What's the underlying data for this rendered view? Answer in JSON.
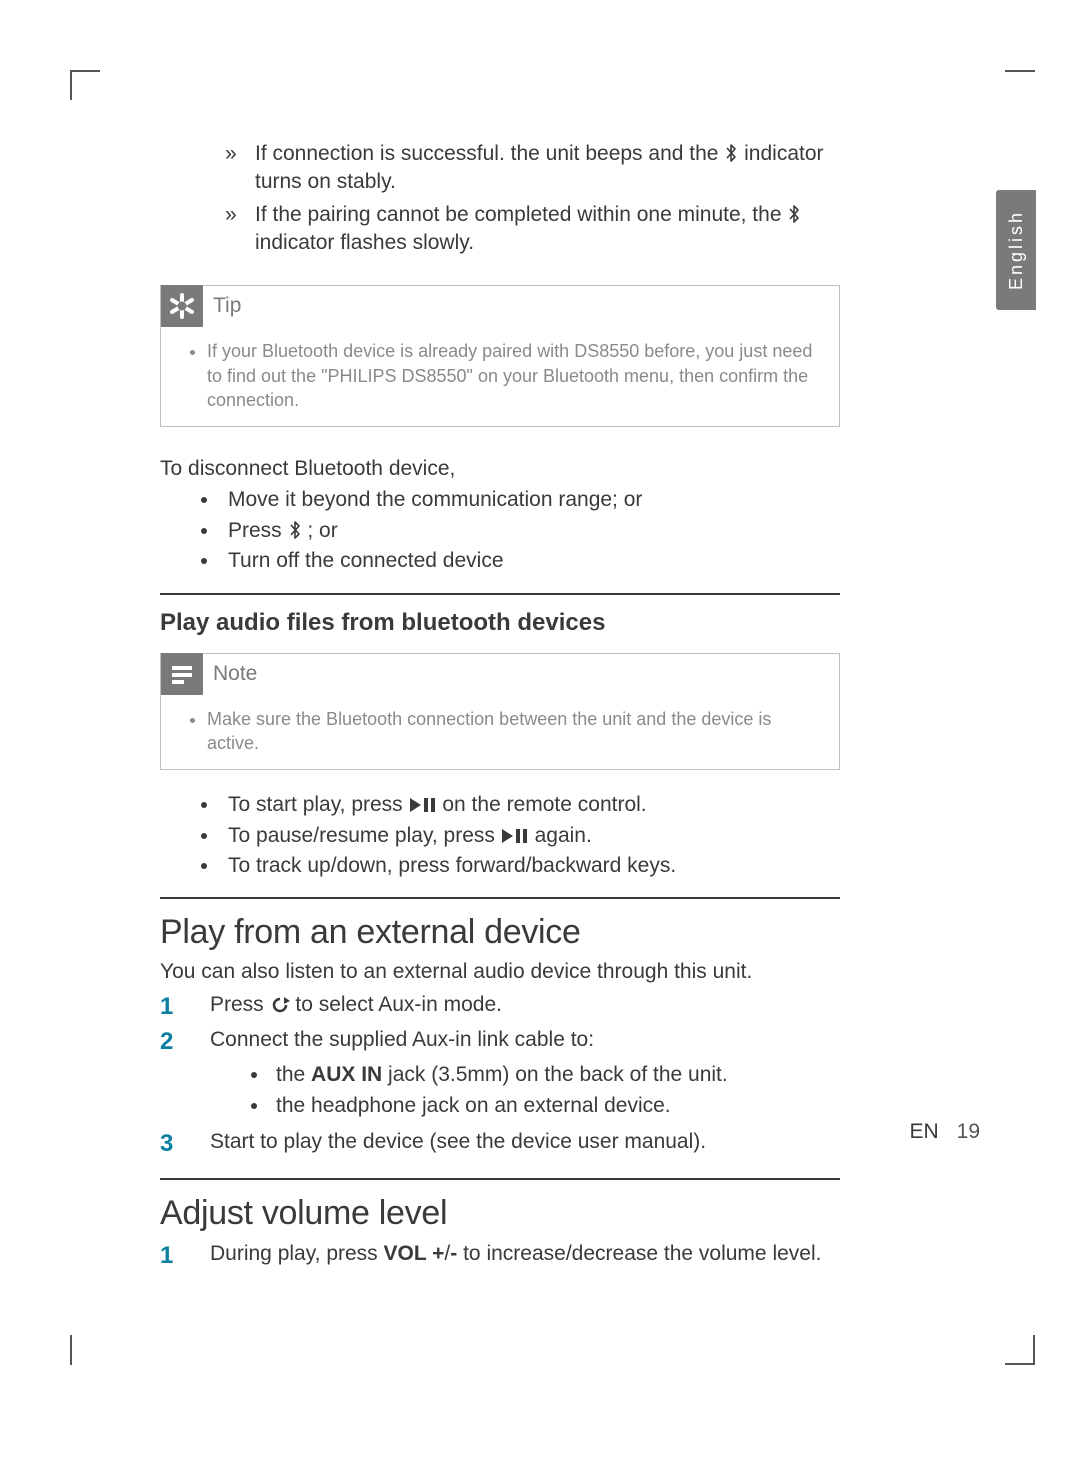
{
  "language_tab": "English",
  "results": [
    {
      "pre": "If connection is successful. the unit beeps and the ",
      "post": " indicator turns on stably."
    },
    {
      "pre": "If the pairing cannot be completed within one minute, the ",
      "post": " indicator flashes slowly."
    }
  ],
  "tip": {
    "title": "Tip",
    "body": "If your Bluetooth device is already paired with DS8550 before, you just need to find out the \"PHILIPS DS8550\" on your Bluetooth menu, then confirm the connection."
  },
  "disconnect": {
    "heading": "To disconnect Bluetooth device,",
    "items": {
      "a": "Move it beyond the communication range; or",
      "b_pre": "Press ",
      "b_post": " ; or",
      "c": "Turn off the connected device"
    }
  },
  "play_bt": {
    "heading": "Play audio files from bluetooth devices",
    "note_title": "Note",
    "note_body": "Make sure the Bluetooth connection between the unit and the device is active.",
    "items": {
      "a_pre": "To start play, press ",
      "a_post": " on the remote control.",
      "b_pre": "To pause/resume play, press ",
      "b_post": " again.",
      "c": "To track up/down, press forward/backward keys."
    }
  },
  "external": {
    "heading": "Play from an external device",
    "intro": "You can also listen to an external audio device through this unit.",
    "step1_pre": "Press ",
    "step1_post": " to select Aux-in mode.",
    "step2": "Connect the supplied Aux-in link cable to:",
    "step2a_pre": "the ",
    "step2a_bold": "AUX IN",
    "step2a_post": "  jack (3.5mm) on the back of the unit.",
    "step2b": "the headphone jack on an external device.",
    "step3": "Start to play the device (see the device user manual)."
  },
  "volume": {
    "heading": "Adjust volume level",
    "step1_pre": "During play, press ",
    "step1_bold": "VOL +",
    "step1_mid": "/",
    "step1_bold2": "-",
    "step1_post": " to increase/decrease the volume level."
  },
  "footer": {
    "lang": "EN",
    "page": "19"
  }
}
